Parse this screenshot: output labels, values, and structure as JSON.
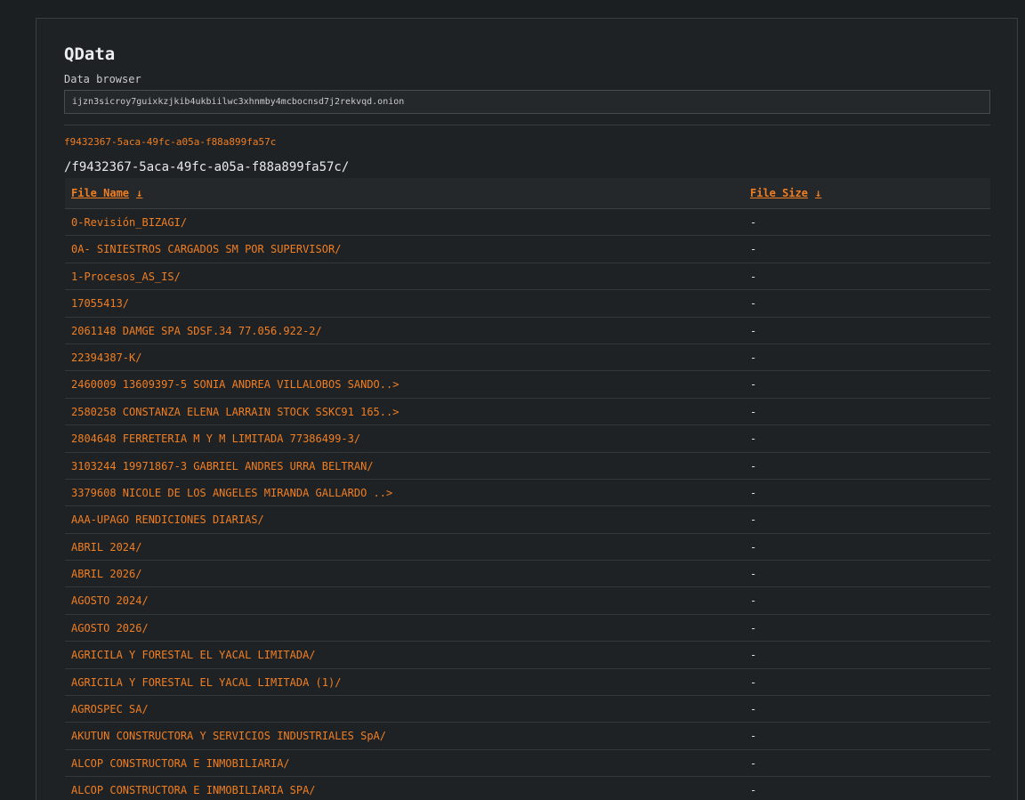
{
  "app": {
    "title": "QData",
    "subtitle": "Data browser"
  },
  "address_bar": {
    "value": "ijzn3sicroy7guixkzjkib4ukbiilwc3xhnmby4mcbocnsd7j2rekvqd.onion"
  },
  "breadcrumb": {
    "link": "f9432367-5aca-49fc-a05a-f88a899fa57c"
  },
  "current_path": "/f9432367-5aca-49fc-a05a-f88a899fa57c/",
  "table": {
    "columns": {
      "name": "File Name",
      "size": "File Size",
      "sort_icon": "↓"
    },
    "rows": [
      {
        "name": "0-Revisión_BIZAGI/",
        "size": "-"
      },
      {
        "name": "0A- SINIESTROS CARGADOS SM POR SUPERVISOR/",
        "size": "-"
      },
      {
        "name": "1-Procesos_AS_IS/",
        "size": "-"
      },
      {
        "name": "17055413/",
        "size": "-"
      },
      {
        "name": "2061148 DAMGE SPA SDSF.34 77.056.922-2/",
        "size": "-"
      },
      {
        "name": "22394387-K/",
        "size": "-"
      },
      {
        "name": "2460009 13609397-5 SONIA ANDREA VILLALOBOS SANDO..>",
        "size": "-"
      },
      {
        "name": "2580258 CONSTANZA ELENA LARRAIN STOCK SSKC91 165..>",
        "size": "-"
      },
      {
        "name": "2804648 FERRETERIA M Y M LIMITADA 77386499-3/",
        "size": "-"
      },
      {
        "name": "3103244 19971867-3 GABRIEL ANDRES URRA BELTRAN/",
        "size": "-"
      },
      {
        "name": "3379608 NICOLE DE LOS ANGELES MIRANDA GALLARDO ..>",
        "size": "-"
      },
      {
        "name": "AAA-UPAGO RENDICIONES DIARIAS/",
        "size": "-"
      },
      {
        "name": "ABRIL 2024/",
        "size": "-"
      },
      {
        "name": "ABRIL 2026/",
        "size": "-"
      },
      {
        "name": "AGOSTO 2024/",
        "size": "-"
      },
      {
        "name": "AGOSTO 2026/",
        "size": "-"
      },
      {
        "name": "AGRICILA Y FORESTAL EL YACAL LIMITADA/",
        "size": "-"
      },
      {
        "name": "AGRICILA Y FORESTAL EL YACAL LIMITADA (1)/",
        "size": "-"
      },
      {
        "name": "AGROSPEC SA/",
        "size": "-"
      },
      {
        "name": "AKUTUN CONSTRUCTORA Y SERVICIOS INDUSTRIALES SpA/",
        "size": "-"
      },
      {
        "name": "ALCOP CONSTRUCTORA E INMOBILIARIA/",
        "size": "-"
      },
      {
        "name": "ALCOP CONSTRUCTORA E INMOBILIARIA SPA/",
        "size": "-"
      }
    ]
  },
  "colors": {
    "accent": "#f07e22",
    "background": "#1c1f22",
    "panel": "#1f2225"
  }
}
